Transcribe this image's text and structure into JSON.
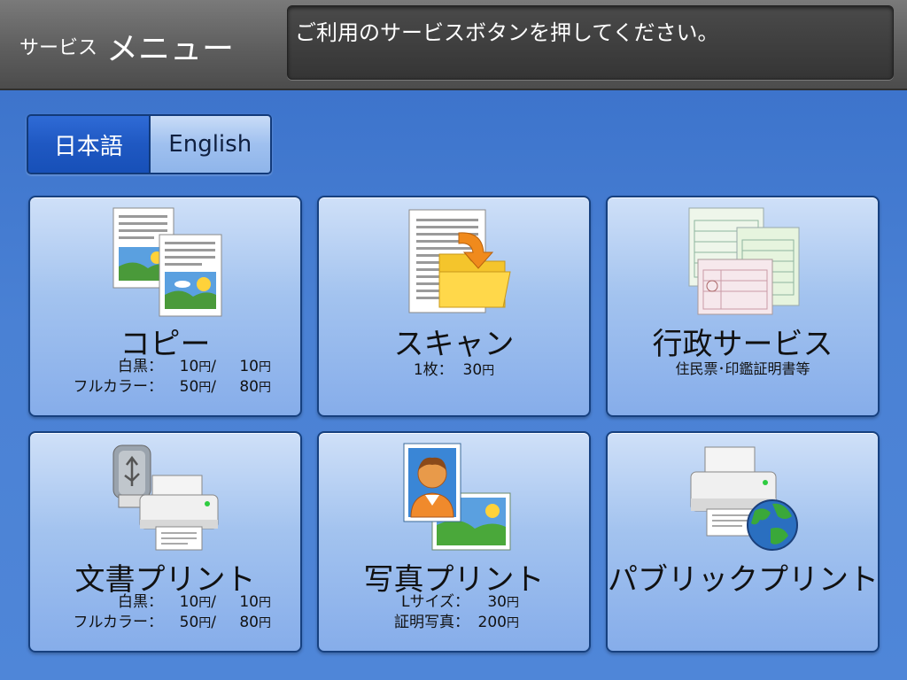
{
  "header": {
    "title_small": "サービス",
    "title_big": "メニュー",
    "message": "ご利用のサービスボタンを押してください。"
  },
  "language": {
    "active_label": "日本語",
    "inactive_label": "English"
  },
  "yen_symbol": "円",
  "tiles": [
    {
      "title": "コピー",
      "icon": "copy-documents-icon",
      "prices": [
        {
          "label": "白黒：",
          "v1": "10",
          "sep": "/",
          "v2": "10"
        },
        {
          "label": "フルカラー：",
          "v1": "50",
          "sep": "/",
          "v2": "80"
        }
      ]
    },
    {
      "title": "スキャン",
      "icon": "scan-folder-icon",
      "price_line": {
        "label": "1枚：",
        "value": "30"
      }
    },
    {
      "title": "行政サービス",
      "icon": "certificates-icon",
      "subtitle": "住民票･印鑑証明書等"
    },
    {
      "title": "文書プリント",
      "icon": "usb-printer-icon",
      "prices": [
        {
          "label": "白黒：",
          "v1": "10",
          "sep": "/",
          "v2": "10"
        },
        {
          "label": "フルカラー：",
          "v1": "50",
          "sep": "/",
          "v2": "80"
        }
      ]
    },
    {
      "title": "写真プリント",
      "icon": "photo-print-icon",
      "photo_prices": [
        {
          "label": "Lサイズ：",
          "value": "30"
        },
        {
          "label": "証明写真：",
          "value": "200"
        }
      ]
    },
    {
      "title": "パブリックプリント",
      "icon": "globe-printer-icon"
    }
  ],
  "colors": {
    "header_bg": "#5e5e5e",
    "main_bg": "#4a81d4",
    "tile_bg": "#a3c3ef",
    "active_lang": "#1f58c2"
  }
}
